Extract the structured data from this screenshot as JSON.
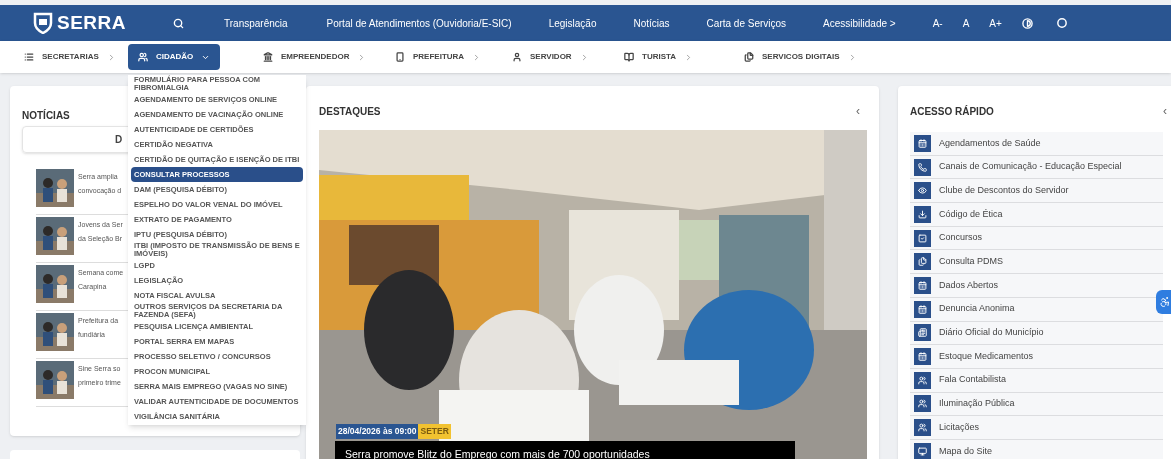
{
  "header": {
    "logo_text": "SERRA",
    "links": [
      "Transparência",
      "Portal de Atendimentos (Ouvidoria/E-SIC)",
      "Legislação",
      "Notícias",
      "Carta de Serviços",
      "Acessibilidade >"
    ],
    "font_controls": [
      "A-",
      "A",
      "A+"
    ]
  },
  "nav": {
    "items": [
      {
        "label": "SECRETARIAS",
        "selected": false
      },
      {
        "label": "CIDADÃO",
        "selected": true
      },
      {
        "label": "EMPREENDEDOR",
        "selected": false
      },
      {
        "label": "PREFEITURA",
        "selected": false
      },
      {
        "label": "SERVIDOR",
        "selected": false
      },
      {
        "label": "TURISTA",
        "selected": false
      },
      {
        "label": "SERVICOS DIGITAIS",
        "selected": false
      }
    ]
  },
  "dropdown": {
    "items": [
      {
        "label": "FORMULÁRIO PARA PESSOA COM FIBROMIALGIA",
        "selected": false
      },
      {
        "label": "AGENDAMENTO DE SERVIÇOS ONLINE",
        "selected": false
      },
      {
        "label": "AGENDAMENTO DE VACINAÇÃO ONLINE",
        "selected": false
      },
      {
        "label": "AUTENTICIDADE DE CERTIDÕES",
        "selected": false
      },
      {
        "label": "CERTIDÃO NEGATIVA",
        "selected": false
      },
      {
        "label": "CERTIDÃO DE QUITAÇÃO E ISENÇÃO DE ITBI",
        "selected": false
      },
      {
        "label": "CONSULTAR PROCESSOS",
        "selected": true
      },
      {
        "label": "DAM (PESQUISA DÉBITO)",
        "selected": false
      },
      {
        "label": "ESPELHO DO VALOR VENAL DO IMÓVEL",
        "selected": false
      },
      {
        "label": "EXTRATO DE PAGAMENTO",
        "selected": false
      },
      {
        "label": "IPTU (PESQUISA DÉBITO)",
        "selected": false
      },
      {
        "label": "ITBI (IMPOSTO DE TRANSMISSÃO DE BENS E IMÓVEIS)",
        "selected": false
      },
      {
        "label": "LGPD",
        "selected": false
      },
      {
        "label": "LEGISLAÇÃO",
        "selected": false
      },
      {
        "label": "NOTA FISCAL AVULSA",
        "selected": false
      },
      {
        "label": "OUTROS SERVIÇOS DA SECRETARIA DA FAZENDA (SEFA)",
        "selected": false
      },
      {
        "label": "PESQUISA LICENÇA AMBIENTAL",
        "selected": false
      },
      {
        "label": "PORTAL SERRA EM MAPAS",
        "selected": false
      },
      {
        "label": "PROCESSO SELETIVO / CONCURSOS",
        "selected": false
      },
      {
        "label": "PROCON MUNICIPAL",
        "selected": false
      },
      {
        "label": "SERRA MAIS EMPREGO (VAGAS NO SINE)",
        "selected": false
      },
      {
        "label": "VALIDAR AUTENTICIDADE DE DOCUMENTOS",
        "selected": false
      },
      {
        "label": "VIGILÂNCIA SANITÁRIA",
        "selected": false
      }
    ]
  },
  "news": {
    "title": "NOTÍCIAS",
    "tab_label": "D",
    "items": [
      {
        "lines": [
          "Serra amplia",
          "convocação d"
        ]
      },
      {
        "lines": [
          "Jovens da Ser",
          "da Seleção Br"
        ]
      },
      {
        "lines": [
          "Semana come",
          "Carapina"
        ]
      },
      {
        "lines": [
          "Prefeitura da",
          "fundiária"
        ]
      },
      {
        "lines": [
          "Sine Serra so",
          "primeiro trime"
        ]
      }
    ]
  },
  "highlights": {
    "title": "DESTAQUES",
    "collapse": "‹",
    "date": "28/04/2026 às 09:00",
    "tag": "SETER",
    "caption": "Serra promove Blitz do Emprego com mais de 700 oportunidades"
  },
  "quick_access": {
    "title": "ACESSO RÁPIDO",
    "collapse": "‹",
    "items": [
      "Agendamentos de Saúde",
      "Canais de Comunicação - Educação Especial",
      "Clube de Descontos do Servidor",
      "Código de Ética",
      "Concursos",
      "Consulta PDMS",
      "Dados Abertos",
      "Denuncia Anonima",
      "Diário Oficial do Município",
      "Estoque Medicamentos",
      "Fala Contabilista",
      "Iluminação Pública",
      "Licitações",
      "Mapa do Site"
    ]
  }
}
